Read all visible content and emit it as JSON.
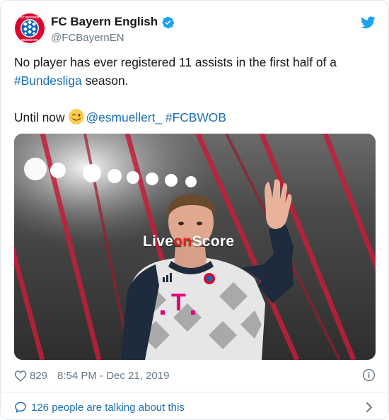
{
  "account": {
    "display_name": "FC Bayern English",
    "handle": "@FCBayernEN",
    "verified": true,
    "avatar_icon": "fc-bayern-crest-icon",
    "avatar_crest_text": "FC BAYERN MÜNCHEN"
  },
  "tweet": {
    "line1": "No player has ever registered 11 assists in the first half of a",
    "hashtag_bundesliga": "#Bundesliga",
    "line2_rest": " season.",
    "until_now": "Until now",
    "emoji": "winking-face-emoji",
    "mention": "@esmuellert_",
    "hashtag_match": "#FCBWOB"
  },
  "media": {
    "watermark_part1": "Live",
    "watermark_part2": "on",
    "watermark_part3": "Score",
    "shirt_sponsor": "T"
  },
  "meta": {
    "likes": "829",
    "timestamp": "8:54 PM - Dec 21, 2019"
  },
  "footer": {
    "talking_text": "126 people are talking about this"
  },
  "colors": {
    "link": "#1b6fb5",
    "verified": "#1da1f2",
    "twitter_bird": "#1da1f2",
    "bayern_red": "#dc052d"
  }
}
